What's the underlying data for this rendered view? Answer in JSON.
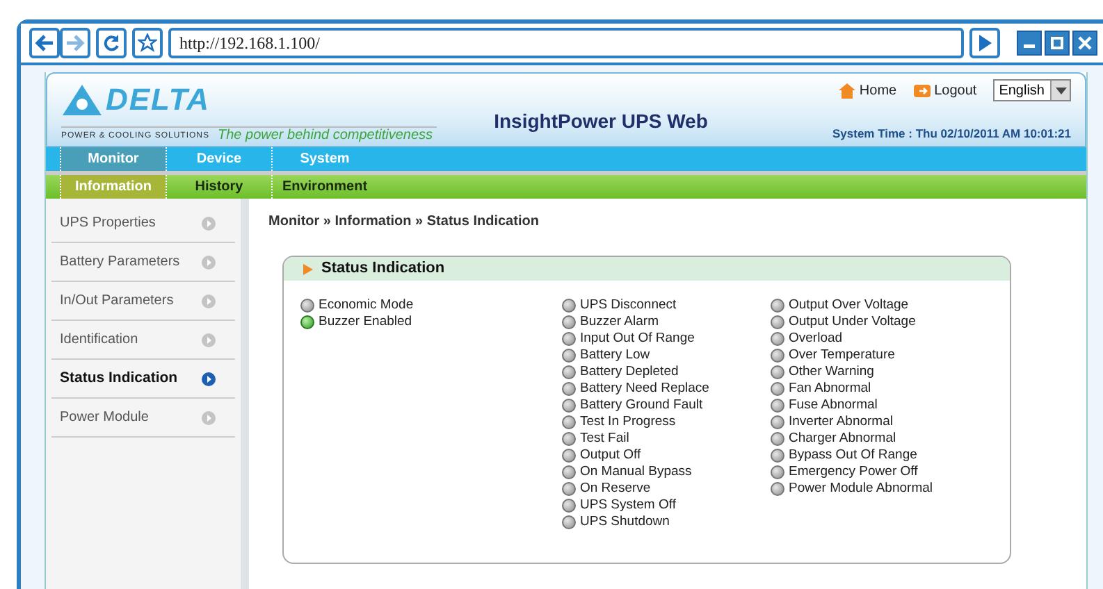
{
  "browser": {
    "url": "http://192.168.1.100/"
  },
  "header": {
    "brand": "DELTA",
    "brand_sub": "POWER & COOLING SOLUTIONS",
    "slogan": "The power behind competitiveness",
    "title": "InsightPower UPS Web",
    "links": [
      "Home",
      "Logout"
    ],
    "language": "English",
    "system_time": "System Time : Thu 02/10/2011 AM 10:01:21"
  },
  "nav": [
    {
      "label": "Monitor",
      "selected": true
    },
    {
      "label": "Device",
      "selected": false
    },
    {
      "label": "System",
      "selected": false
    }
  ],
  "subnav": [
    {
      "label": "Information",
      "selected": true
    },
    {
      "label": "History",
      "selected": false
    },
    {
      "label": "Environment",
      "selected": false
    }
  ],
  "sidebar": {
    "items": [
      {
        "label": "UPS Properties",
        "selected": false
      },
      {
        "label": "Battery Parameters",
        "selected": false
      },
      {
        "label": "In/Out Parameters",
        "selected": false
      },
      {
        "label": "Identification",
        "selected": false
      },
      {
        "label": "Status Indication",
        "selected": true
      },
      {
        "label": "Power Module",
        "selected": false
      }
    ]
  },
  "breadcrumb": "Monitor » Information » Status Indication",
  "panel": {
    "title": "Status Indication",
    "columns": [
      [
        {
          "label": "Economic Mode",
          "on": false
        },
        {
          "label": "Buzzer Enabled",
          "on": true
        }
      ],
      [
        {
          "label": "UPS Disconnect",
          "on": false
        },
        {
          "label": "Buzzer Alarm",
          "on": false
        },
        {
          "label": "Input Out Of Range",
          "on": false
        },
        {
          "label": "Battery Low",
          "on": false
        },
        {
          "label": "Battery Depleted",
          "on": false
        },
        {
          "label": "Battery Need Replace",
          "on": false
        },
        {
          "label": "Battery Ground Fault",
          "on": false
        },
        {
          "label": "Test In Progress",
          "on": false
        },
        {
          "label": "Test Fail",
          "on": false
        },
        {
          "label": "Output Off",
          "on": false
        },
        {
          "label": "On Manual Bypass",
          "on": false
        },
        {
          "label": "On Reserve",
          "on": false
        },
        {
          "label": "UPS System Off",
          "on": false
        },
        {
          "label": "UPS Shutdown",
          "on": false
        }
      ],
      [
        {
          "label": "Output Over Voltage",
          "on": false
        },
        {
          "label": "Output Under Voltage",
          "on": false
        },
        {
          "label": "Overload",
          "on": false
        },
        {
          "label": "Over Temperature",
          "on": false
        },
        {
          "label": "Other Warning",
          "on": false
        },
        {
          "label": "Fan Abnormal",
          "on": false
        },
        {
          "label": "Fuse Abnormal",
          "on": false
        },
        {
          "label": "Inverter Abnormal",
          "on": false
        },
        {
          "label": "Charger Abnormal",
          "on": false
        },
        {
          "label": "Bypass Out Of Range",
          "on": false
        },
        {
          "label": "Emergency Power Off",
          "on": false
        },
        {
          "label": "Power Module Abnormal",
          "on": false
        }
      ]
    ]
  }
}
